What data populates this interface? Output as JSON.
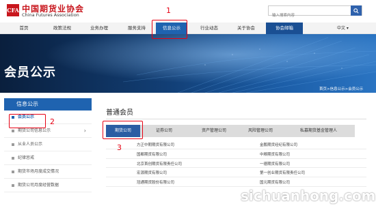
{
  "header": {
    "logo_mark": "CFA",
    "logo_cn": "中国期货业协会",
    "logo_en": "China Futures Association",
    "search_placeholder": "输入搜索内容"
  },
  "nav": {
    "items": [
      "首页",
      "政策法规",
      "业务办理",
      "服务支持",
      "信息公示",
      "行业动态",
      "关于协会",
      "协会邮箱"
    ],
    "language": "中文 ▾"
  },
  "banner": {
    "title": "会员公示",
    "breadcrumb": "首页>信息公示>会员公示"
  },
  "sidebar": {
    "title": "信息公示",
    "items": [
      "会员公示",
      "期货公司信息公示",
      "从业人员公示",
      "纪律惩戒",
      "期货市场月度成交情况",
      "期货公司月度经营数据"
    ]
  },
  "main": {
    "title": "普通会员",
    "tabs": [
      "期货公司",
      "证券公司",
      "资产管理公司",
      "风险管理公司",
      "私募期货基金管理人"
    ],
    "rows": [
      [
        "方正中期期货有限公司",
        "金鹏期货经纪有限公司"
      ],
      [
        "国都期货有限公司",
        "中粮期货有限公司"
      ],
      [
        "北京首创期货有限责任公司",
        "一德期货有限公司"
      ],
      [
        "宏源期货有限公司",
        "第一创业期货有限责任公司"
      ],
      [
        "冠通期货股份有限公司",
        "国元期货有限公司"
      ]
    ]
  },
  "annotations": [
    "1",
    "2",
    "3"
  ],
  "watermark": "sichuanhong.com",
  "colors": {
    "brand_red": "#c8161d",
    "nav_active": "#1f63b0",
    "annotation_red": "#e60012"
  }
}
